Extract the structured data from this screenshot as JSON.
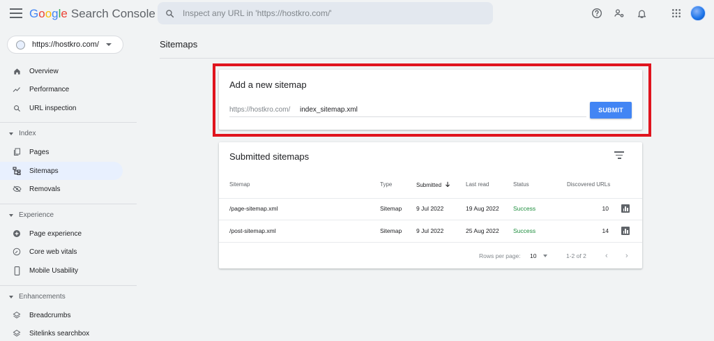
{
  "header": {
    "logo_letters": [
      {
        "char": "G",
        "color": "#4285f4"
      },
      {
        "char": "o",
        "color": "#ea4335"
      },
      {
        "char": "o",
        "color": "#fbbc05"
      },
      {
        "char": "g",
        "color": "#4285f4"
      },
      {
        "char": "l",
        "color": "#34a853"
      },
      {
        "char": "e",
        "color": "#ea4335"
      }
    ],
    "product": "Search Console",
    "search_placeholder": "Inspect any URL in 'https://hostkro.com/'",
    "icons": [
      "help-icon",
      "manage-users-icon",
      "notifications-icon",
      "apps-grid-icon"
    ]
  },
  "sidebar": {
    "property": "https://hostkro.com/",
    "top_items": [
      {
        "label": "Overview",
        "icon": "home-icon"
      },
      {
        "label": "Performance",
        "icon": "trend-icon"
      },
      {
        "label": "URL inspection",
        "icon": "search-icon"
      }
    ],
    "index_section": "Index",
    "index_items": [
      {
        "label": "Pages",
        "icon": "pages-icon"
      },
      {
        "label": "Sitemaps",
        "icon": "sitemap-icon",
        "active": true
      },
      {
        "label": "Removals",
        "icon": "removals-icon"
      }
    ],
    "experience_section": "Experience",
    "experience_items": [
      {
        "label": "Page experience",
        "icon": "plus-circle-icon"
      },
      {
        "label": "Core web vitals",
        "icon": "gauge-icon"
      },
      {
        "label": "Mobile Usability",
        "icon": "phone-icon"
      }
    ],
    "enhancements_section": "Enhancements",
    "enhancement_items": [
      {
        "label": "Breadcrumbs",
        "icon": "layers-icon"
      },
      {
        "label": "Sitelinks searchbox",
        "icon": "layers-icon"
      }
    ]
  },
  "main": {
    "page_title": "Sitemaps",
    "add_sitemap": {
      "title": "Add a new sitemap",
      "prefix": "https://hostkro.com/",
      "input_value": "index_sitemap.xml",
      "submit_label": "SUBMIT"
    },
    "submitted": {
      "title": "Submitted sitemaps",
      "columns": {
        "sitemap": "Sitemap",
        "type": "Type",
        "submitted": "Submitted",
        "last_read": "Last read",
        "status": "Status",
        "discovered": "Discovered URLs"
      },
      "rows": [
        {
          "sitemap": "/page-sitemap.xml",
          "type": "Sitemap",
          "submitted": "9 Jul 2022",
          "last_read": "19 Aug 2022",
          "status": "Success",
          "discovered": "10"
        },
        {
          "sitemap": "/post-sitemap.xml",
          "type": "Sitemap",
          "submitted": "9 Jul 2022",
          "last_read": "25 Aug 2022",
          "status": "Success",
          "discovered": "14"
        }
      ],
      "rows_per_page_label": "Rows per page:",
      "rows_per_page_value": "10",
      "range": "1-2 of 2"
    }
  },
  "colors": {
    "accent": "#4285f4",
    "success": "#1e8e3e",
    "highlight": "#e0141e",
    "active_nav": "#e8f0fe"
  }
}
